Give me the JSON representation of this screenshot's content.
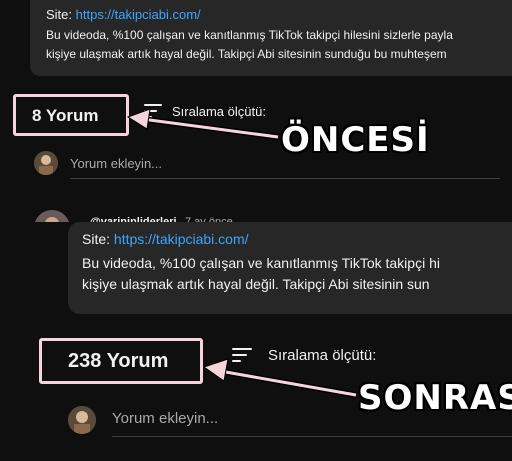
{
  "before": {
    "site_label": "Site:",
    "site_url": "https://takipciabi.com/",
    "desc_line1": "Bu videoda, %100 çalışan ve kanıtlanmış TikTok takipçi hilesini sizlerle payla",
    "desc_line2": "kişiye ulaşmak artık hayal değil. Takipçi Abi sitesinin sunduğu bu muhteşem",
    "comment_count": "8 Yorum",
    "sort_label": "Sıralama ölçütü:",
    "add_comment_placeholder": "Yorum ekleyin...",
    "next_comment_user": "@varininliderleri",
    "next_comment_time": "7 ay önce",
    "annotation": "ÖNCESİ"
  },
  "after": {
    "site_label": "Site:",
    "site_url": "https://takipciabi.com/",
    "desc_line1": "Bu videoda, %100 çalışan ve kanıtlanmış TikTok takipçi hi",
    "desc_line2": "kişiye ulaşmak artık hayal değil. Takipçi Abi sitesinin sun",
    "comment_count": "238 Yorum",
    "sort_label": "Sıralama ölçütü:",
    "add_comment_placeholder": "Yorum ekleyin...",
    "annotation": "SONRASI"
  },
  "colors": {
    "background": "#0f0f0f",
    "card": "#272727",
    "link": "#3ea6ff",
    "highlight_box": "#f7d4dc",
    "arrow": "#f7d4dc"
  }
}
